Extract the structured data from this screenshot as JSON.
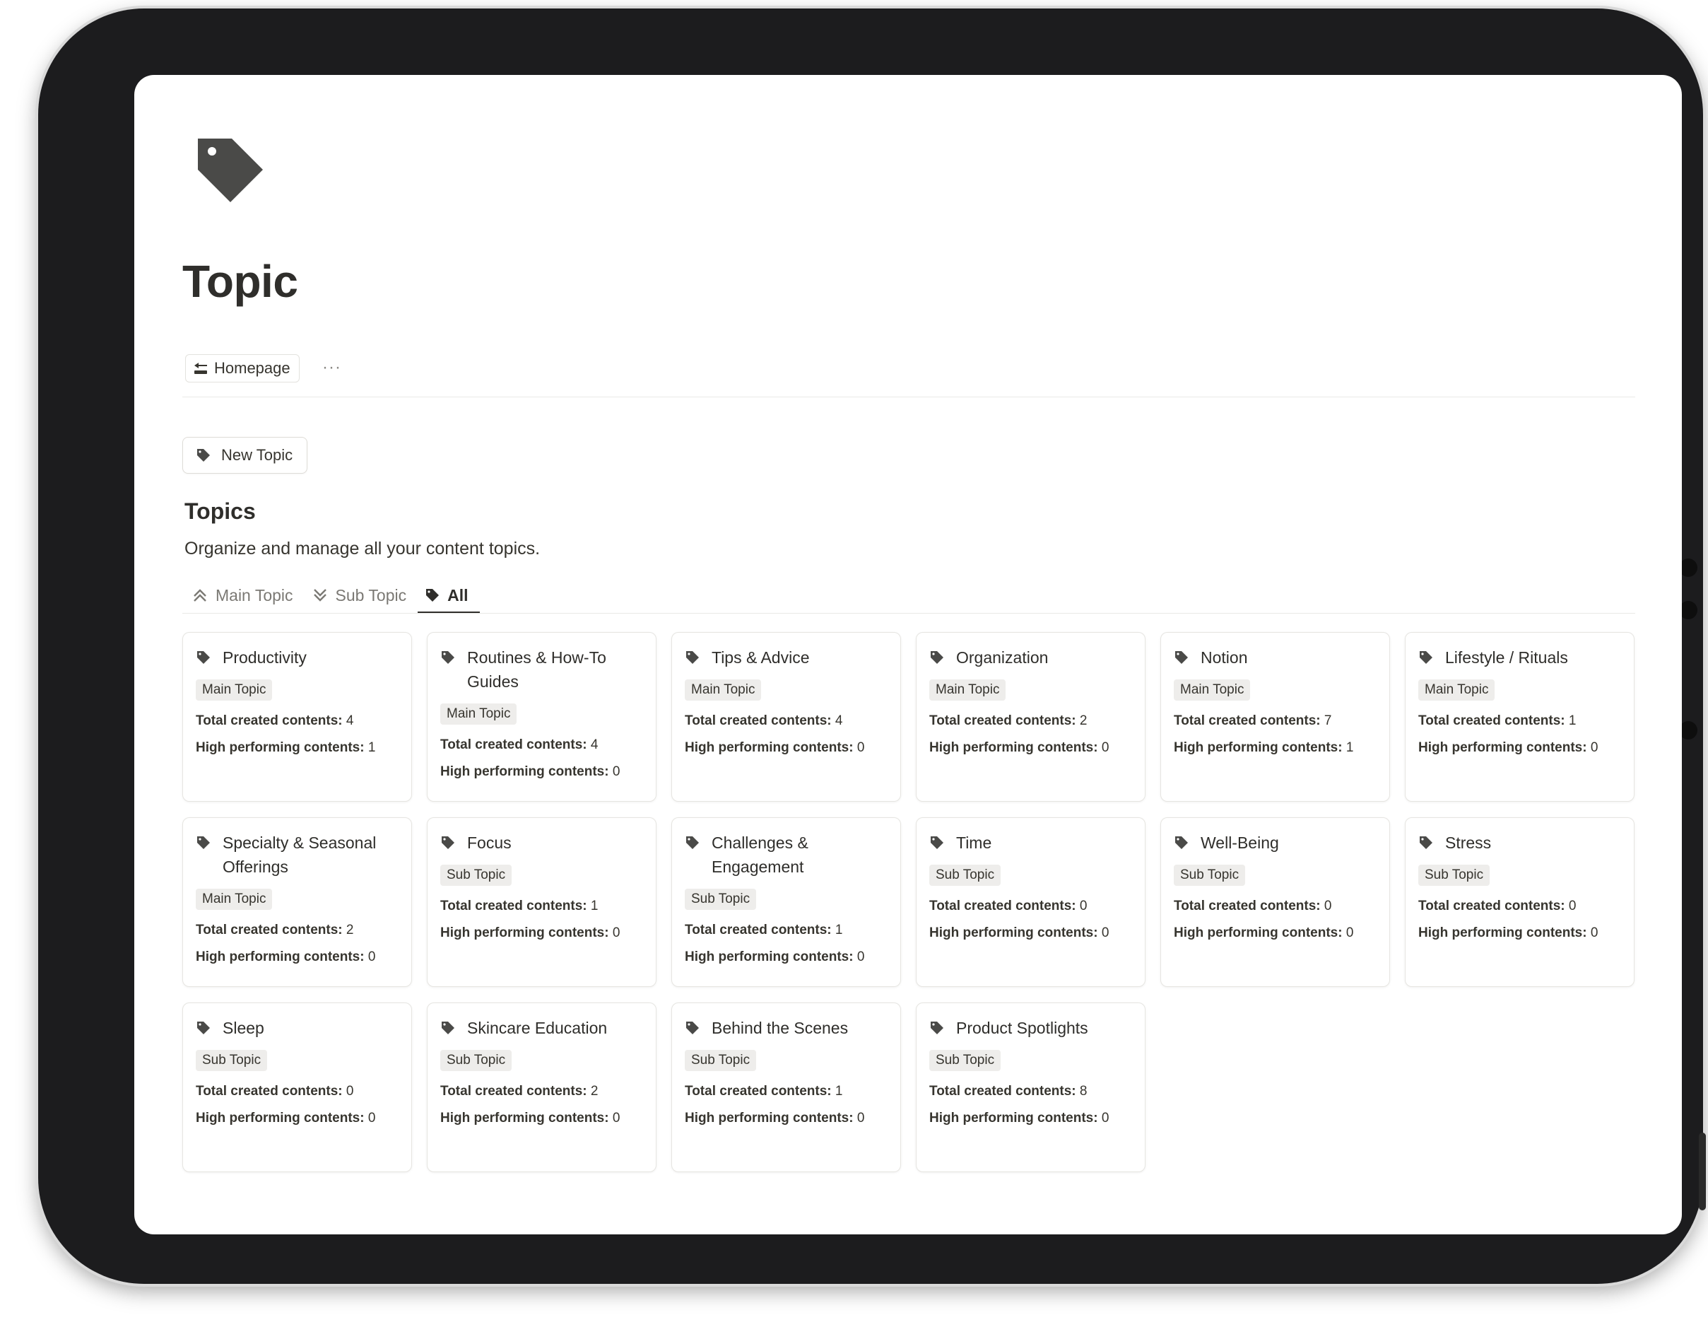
{
  "page": {
    "title": "Topic",
    "icon": "tag-icon"
  },
  "toolbar": {
    "homepage_label": "Homepage",
    "more_label": "···"
  },
  "actions": {
    "new_topic_label": "New Topic"
  },
  "section": {
    "title": "Topics",
    "description": "Organize and manage all your content topics."
  },
  "tabs": [
    {
      "label": "Main Topic",
      "icon": "double-chevron-up-icon",
      "active": false
    },
    {
      "label": "Sub Topic",
      "icon": "double-chevron-down-icon",
      "active": false
    },
    {
      "label": "All",
      "icon": "tag-icon",
      "active": true
    }
  ],
  "labels": {
    "total": "Total created contents:",
    "high": "High performing contents:"
  },
  "cards": [
    {
      "title": "Productivity",
      "tag": "Main Topic",
      "total": "4",
      "high": "1"
    },
    {
      "title": "Routines & How-To Guides",
      "tag": "Main Topic",
      "total": "4",
      "high": "0"
    },
    {
      "title": "Tips & Advice",
      "tag": "Main Topic",
      "total": "4",
      "high": "0"
    },
    {
      "title": "Organization",
      "tag": "Main Topic",
      "total": "2",
      "high": "0"
    },
    {
      "title": "Notion",
      "tag": "Main Topic",
      "total": "7",
      "high": "1"
    },
    {
      "title": "Lifestyle / Rituals",
      "tag": "Main Topic",
      "total": "1",
      "high": "0"
    },
    {
      "title": "Specialty & Seasonal Offerings",
      "tag": "Main Topic",
      "total": "2",
      "high": "0"
    },
    {
      "title": "Focus",
      "tag": "Sub Topic",
      "total": "1",
      "high": "0"
    },
    {
      "title": "Challenges & Engagement",
      "tag": "Sub Topic",
      "total": "1",
      "high": "0"
    },
    {
      "title": "Time",
      "tag": "Sub Topic",
      "total": "0",
      "high": "0"
    },
    {
      "title": "Well-Being",
      "tag": "Sub Topic",
      "total": "0",
      "high": "0"
    },
    {
      "title": "Stress",
      "tag": "Sub Topic",
      "total": "0",
      "high": "0"
    },
    {
      "title": "Sleep",
      "tag": "Sub Topic",
      "total": "0",
      "high": "0"
    },
    {
      "title": "Skincare Education",
      "tag": "Sub Topic",
      "total": "2",
      "high": "0"
    },
    {
      "title": "Behind the Scenes",
      "tag": "Sub Topic",
      "total": "1",
      "high": "0"
    },
    {
      "title": "Product Spotlights",
      "tag": "Sub Topic",
      "total": "8",
      "high": "0"
    }
  ],
  "colors": {
    "text": "#37352f",
    "icon": "#4a4a48",
    "tag_bg": "#eeedeb",
    "device": "#1c1c1e"
  }
}
